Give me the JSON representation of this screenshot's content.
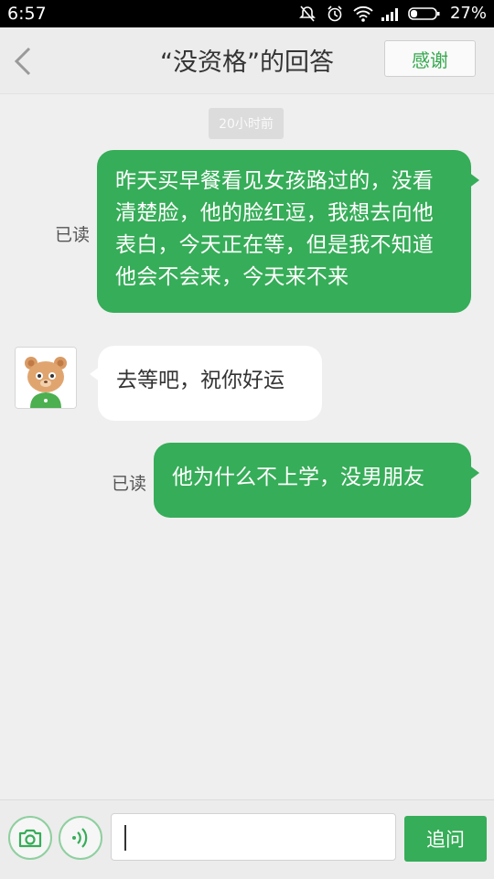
{
  "status_bar": {
    "time": "6:57",
    "battery_percent": "27%",
    "battery_level": 0.27,
    "icons": [
      "alarm-mute-icon",
      "alarm-clock-icon",
      "wifi-icon",
      "signal-icon",
      "battery-icon"
    ]
  },
  "header": {
    "title": "“没资格”的回答",
    "thanks_label": "感谢"
  },
  "conversation": {
    "timestamp": "20小时前",
    "messages": [
      {
        "direction": "outgoing",
        "text": "昨天买早餐看见女孩路过的，没看清楚脸，他的脸红逗，我想去向他表白，今天正在等，但是我不知道他会不会来，今天来不来",
        "status": "已读"
      },
      {
        "direction": "incoming",
        "text": "去等吧，祝你好运",
        "avatar_icon": "bear-avatar-icon"
      },
      {
        "direction": "outgoing",
        "text": "他为什么不上学，没男朋友",
        "status": "已读"
      }
    ]
  },
  "bottom_bar": {
    "camera_icon": "camera-icon",
    "voice_icon": "voice-icon",
    "input_value": "",
    "send_label": "追问"
  },
  "colors": {
    "accent": "#36ad58",
    "background": "#efefef",
    "header": "#ececec"
  }
}
